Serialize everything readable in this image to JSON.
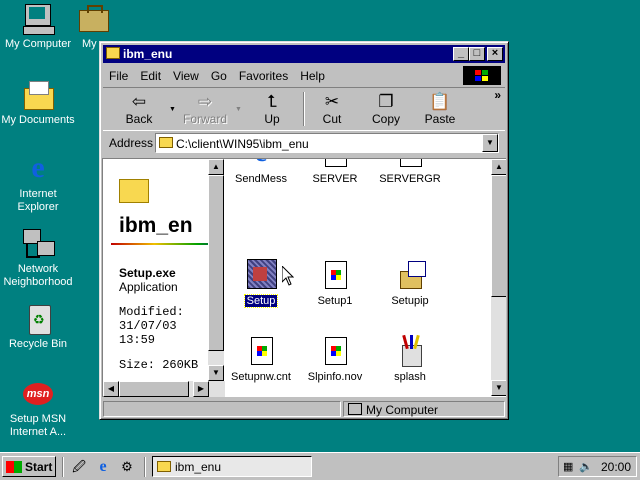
{
  "desktop": {
    "icons": [
      {
        "label": "My Computer"
      },
      {
        "label": "My Documents"
      },
      {
        "label": "Internet Explorer"
      },
      {
        "label": "Network Neighborhood"
      },
      {
        "label": "Recycle Bin"
      },
      {
        "label": "Setup MSN Internet A..."
      }
    ],
    "partial_icon_label": "My",
    "msn_logo_text": "msn"
  },
  "window": {
    "title": "ibm_enu",
    "menu": [
      "File",
      "Edit",
      "View",
      "Go",
      "Favorites",
      "Help"
    ],
    "toolbar": {
      "back": "Back",
      "forward": "Forward",
      "up": "Up",
      "cut": "Cut",
      "copy": "Copy",
      "paste": "Paste",
      "more": "»"
    },
    "address": {
      "label": "Address",
      "value": "C:\\client\\WIN95\\ibm_enu"
    },
    "left_pane": {
      "folder_title": "ibm_en",
      "file_name": "Setup.exe",
      "file_type": "Application",
      "modified_label": "Modified:",
      "modified_date": "31/07/03",
      "modified_time": "13:59",
      "size": "Size: 260KB"
    },
    "files": [
      {
        "name": "SendMess",
        "icon": "ie-icon"
      },
      {
        "name": "SERVER",
        "icon": "exe-icon"
      },
      {
        "name": "SERVERGR",
        "icon": "exe-icon"
      },
      {
        "name": "Setup",
        "icon": "setup-icon",
        "selected": true
      },
      {
        "name": "Setup1",
        "icon": "doc-icon"
      },
      {
        "name": "Setupip",
        "icon": "setup-box-icon"
      },
      {
        "name": "Setupnw.cnt",
        "icon": "doc-icon"
      },
      {
        "name": "Slpinfo.nov",
        "icon": "doc-icon"
      },
      {
        "name": "splash",
        "icon": "paint-icon"
      }
    ],
    "status": {
      "location": "My Computer"
    }
  },
  "taskbar": {
    "start": "Start",
    "task_button": "ibm_enu",
    "clock": "20:00"
  },
  "colors": {
    "desktop": "#008080",
    "title_active": "#000080",
    "face": "#c0c0c0"
  }
}
